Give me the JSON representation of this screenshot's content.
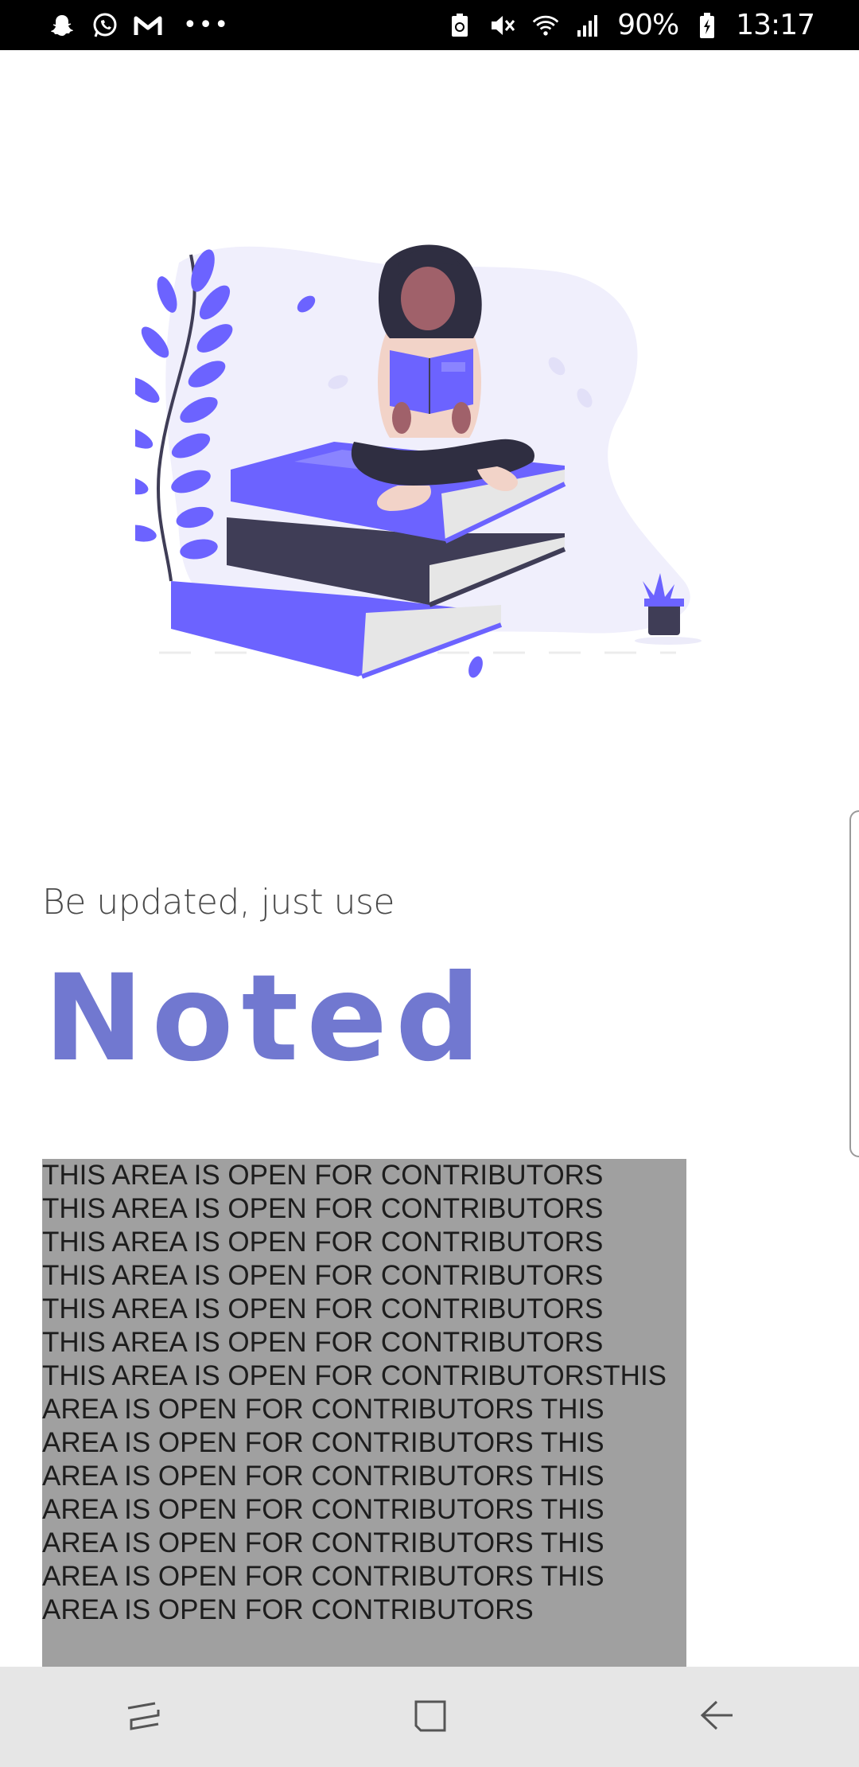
{
  "status_bar": {
    "left_icons": [
      "snapchat-icon",
      "whatsapp-icon",
      "gmail-icon",
      "more-dots-icon"
    ],
    "more_dots": "•••",
    "right_icons": [
      "battery-saver-icon",
      "mute-icon",
      "wifi-icon",
      "signal-icon",
      "battery-charging-icon"
    ],
    "battery_percent": "90%",
    "time": "13:17"
  },
  "main": {
    "subtitle": "Be updated, just use",
    "brand_name": "Noted",
    "contributors_text": "THIS AREA IS OPEN FOR CONTRIBUTORS THIS AREA IS OPEN FOR CONTRIBUTORS THIS AREA IS OPEN FOR CONTRIBUTORS THIS AREA IS OPEN FOR CONTRIBUTORS THIS AREA IS OPEN FOR CONTRIBUTORS THIS AREA IS OPEN FOR CONTRIBUTORS THIS AREA IS OPEN FOR CONTRIBUTORSTHIS AREA IS OPEN FOR CONTRIBUTORS THIS AREA IS OPEN FOR CONTRIBUTORS THIS AREA IS OPEN FOR CONTRIBUTORS THIS AREA IS OPEN FOR CONTRIBUTORS THIS AREA IS OPEN FOR CONTRIBUTORS THIS AREA IS OPEN FOR CONTRIBUTORS THIS AREA IS OPEN FOR CONTRIBUTORS"
  },
  "colors": {
    "brand": "#7178d0",
    "accent_purple": "#6c63ff",
    "contrib_bg": "#a0a0a0",
    "status_bar_bg": "#000000",
    "nav_bar_bg": "#e6e6e6"
  },
  "nav_bar": {
    "buttons": [
      "recents-icon",
      "home-icon",
      "back-icon"
    ]
  }
}
